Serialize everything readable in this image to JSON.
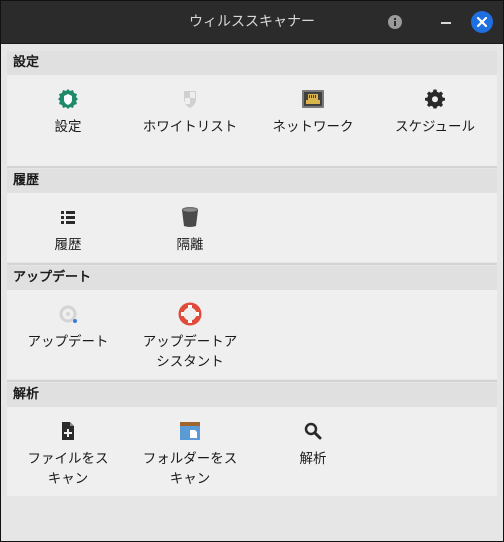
{
  "window": {
    "title": "ウィルススキャナー"
  },
  "sections": {
    "settings": {
      "heading": "設定",
      "items": [
        {
          "label": "設定",
          "icon": "shield-gear-icon"
        },
        {
          "label": "ホワイトリスト",
          "icon": "shield-list-icon"
        },
        {
          "label": "ネットワーク",
          "icon": "network-port-icon"
        },
        {
          "label": "スケジュール",
          "icon": "gear-icon"
        }
      ]
    },
    "history": {
      "heading": "履歴",
      "items": [
        {
          "label": "履歴",
          "icon": "list-icon"
        },
        {
          "label": "隔離",
          "icon": "trash-bin-icon"
        }
      ]
    },
    "update": {
      "heading": "アップデート",
      "items": [
        {
          "label": "アップデート",
          "icon": "update-icon"
        },
        {
          "label": "アップデートア\nシスタント",
          "icon": "lifebuoy-icon"
        }
      ]
    },
    "analysis": {
      "heading": "解析",
      "items": [
        {
          "label": "ファイルをス\nキャン",
          "icon": "file-add-icon"
        },
        {
          "label": "フォルダーをス\nキャン",
          "icon": "folder-icon"
        },
        {
          "label": "解析",
          "icon": "magnifier-icon"
        }
      ]
    }
  },
  "colors": {
    "close_button": "#1f6fe0",
    "settings_icon": "#1d8a6a",
    "lifebuoy": "#e04b3c",
    "folder": "#5b9bd5"
  }
}
